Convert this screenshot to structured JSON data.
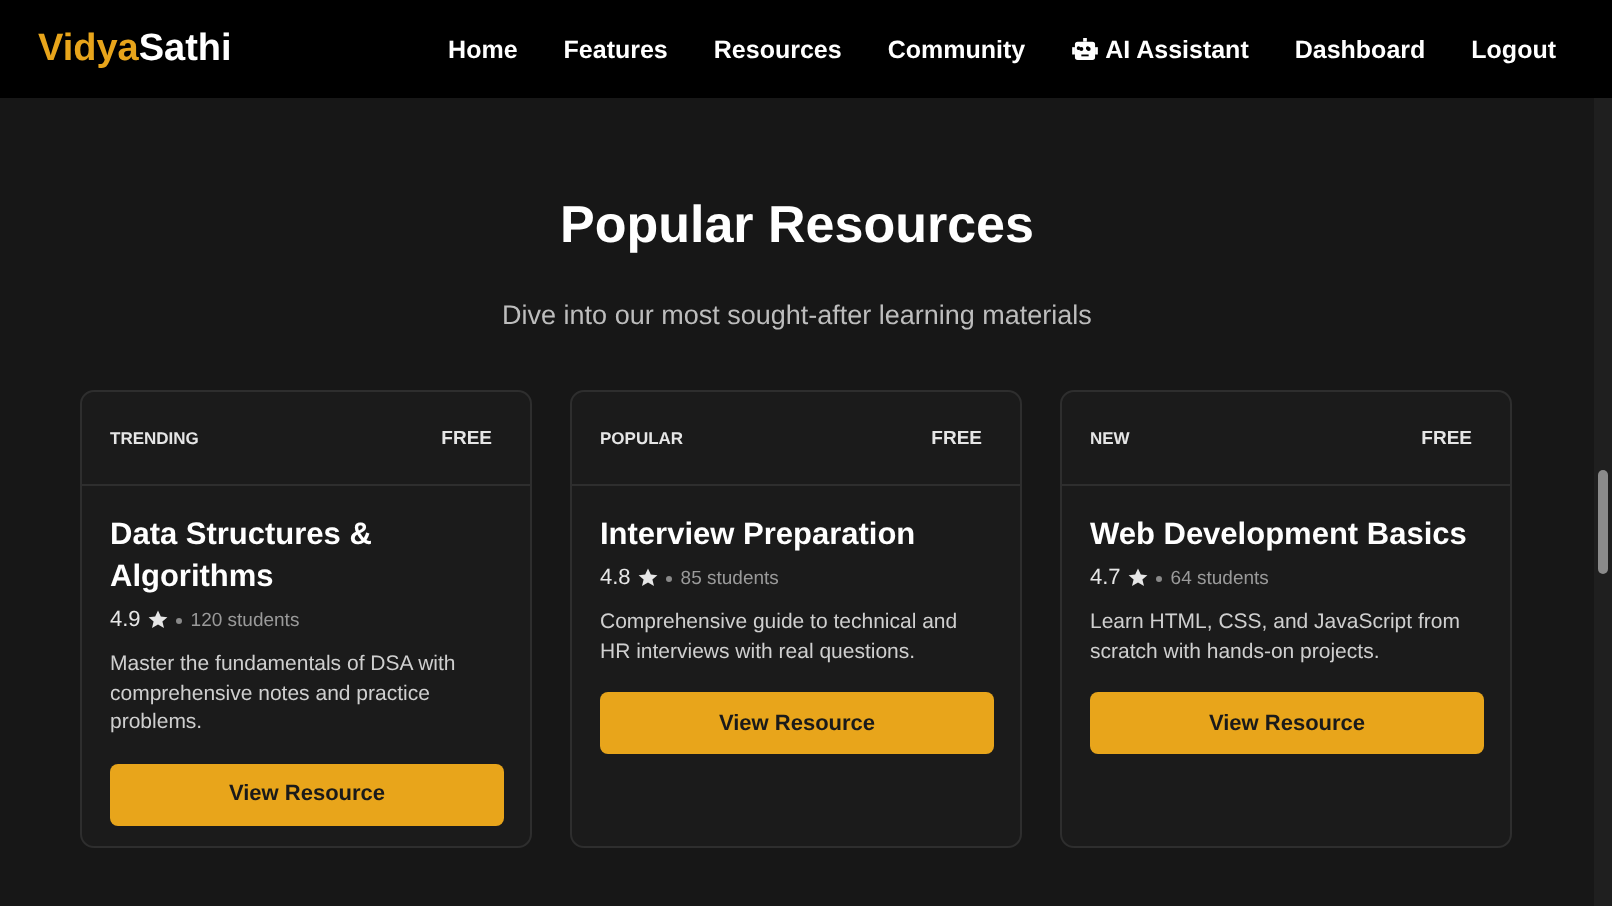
{
  "brand": {
    "first": "Vidya",
    "second": "Sathi"
  },
  "nav": [
    {
      "label": "Home",
      "kind": "link"
    },
    {
      "label": "Features",
      "kind": "link"
    },
    {
      "label": "Resources",
      "kind": "link"
    },
    {
      "label": "Community",
      "kind": "link"
    },
    {
      "label": "AI Assistant",
      "kind": "assistant"
    },
    {
      "label": "Dashboard",
      "kind": "link"
    },
    {
      "label": "Logout",
      "kind": "link"
    }
  ],
  "section": {
    "title": "Popular Resources",
    "subtitle": "Dive into our most sought-after learning materials"
  },
  "cards": [
    {
      "tag": "TRENDING",
      "price": "FREE",
      "title": "Data Structures & Algorithms",
      "rating": "4.9",
      "students": "120 students",
      "description": "Master the fundamentals of DSA with comprehensive notes and practice problems.",
      "button": "View Resource"
    },
    {
      "tag": "POPULAR",
      "price": "FREE",
      "title": "Interview Preparation",
      "rating": "4.8",
      "students": "85 students",
      "description": "Comprehensive guide to technical and HR interviews with real questions.",
      "button": "View Resource"
    },
    {
      "tag": "NEW",
      "price": "FREE",
      "title": "Web Development Basics",
      "rating": "4.7",
      "students": "64 students",
      "description": "Learn HTML, CSS, and JavaScript from scratch with hands-on projects.",
      "button": "View Resource"
    }
  ]
}
